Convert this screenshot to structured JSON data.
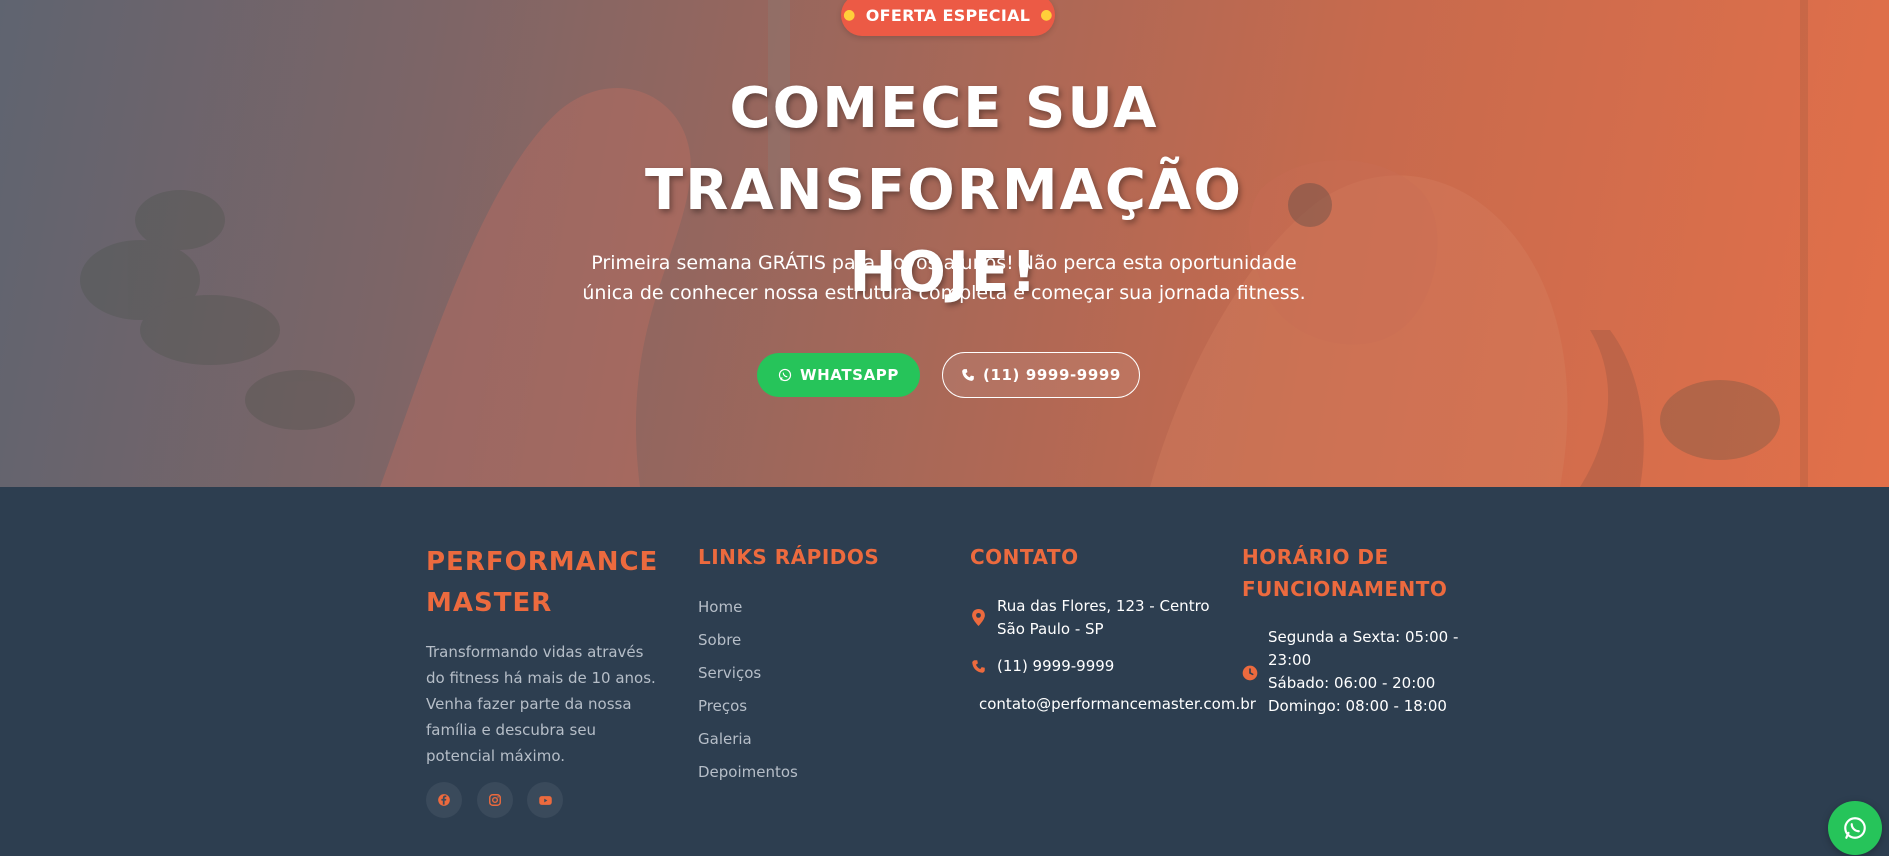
{
  "hero": {
    "badge": "OFERTA ESPECIAL",
    "badge_icon": "fire-icon",
    "title_line1": "COMECE SUA TRANSFORMAÇÃO",
    "title_line2": "HOJE!",
    "subtitle_line1": "Primeira semana GRÁTIS para novos alunos! Não perca esta oportunidade",
    "subtitle_line2": "única de conhecer nossa estrutura completa e começar sua jornada fitness.",
    "whatsapp_button": "WHATSAPP",
    "phone_button": "(11) 9999-9999"
  },
  "footer": {
    "brand_line1": "PERFORMANCE",
    "brand_line2": "MASTER",
    "brand_description": "Transformando vidas através do fitness há mais de 10 anos. Venha fazer parte da nossa família e descubra seu potencial máximo.",
    "social": [
      {
        "icon": "facebook-icon"
      },
      {
        "icon": "instagram-icon"
      },
      {
        "icon": "youtube-icon"
      }
    ],
    "links_title": "LINKS RÁPIDOS",
    "links": [
      "Home",
      "Sobre",
      "Serviços",
      "Preços",
      "Galeria",
      "Depoimentos"
    ],
    "contact_title": "CONTATO",
    "address_line1": "Rua das Flores, 123 - Centro",
    "address_line2": "São Paulo - SP",
    "phone": "(11) 9999-9999",
    "email": "contato@performancemaster.com.br",
    "hours_title_line1": "HORÁRIO DE",
    "hours_title_line2": "FUNCIONAMENTO",
    "hours_line1": "Segunda a Sexta: 05:00 -",
    "hours_line2": "23:00",
    "hours_line3": "Sábado: 06:00 - 20:00",
    "hours_line4": "Domingo: 08:00 - 18:00"
  },
  "colors": {
    "accent": "#ec6a3e",
    "badge": "#ec5a45",
    "whatsapp": "#26c45a",
    "footer_bg": "#2d3e50"
  }
}
